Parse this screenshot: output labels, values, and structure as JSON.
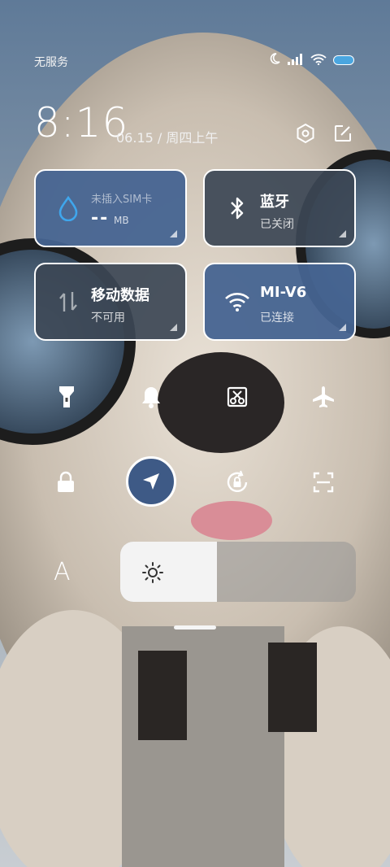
{
  "status_bar": {
    "carrier": "无服务",
    "icons": [
      "moon-icon",
      "signal-icon",
      "wifi-icon",
      "battery-icon"
    ]
  },
  "header": {
    "time": "8:16",
    "date": "06.15 / 周四上午",
    "buttons": [
      "settings-icon",
      "edit-icon"
    ]
  },
  "tiles": {
    "sim": {
      "label": "未插入SIM卡",
      "value": "--",
      "unit": "MB",
      "icon": "water-drop-icon"
    },
    "bluetooth": {
      "title": "蓝牙",
      "subtitle": "已关闭",
      "icon": "bluetooth-icon",
      "state": "off"
    },
    "mobile_data": {
      "title": "移动数据",
      "subtitle": "不可用",
      "icon": "data-arrows-icon",
      "state": "off"
    },
    "wifi": {
      "title": "MI-V6",
      "subtitle": "已连接",
      "icon": "wifi-icon",
      "state": "on"
    }
  },
  "toggles_row1": [
    "flashlight-icon",
    "bell-icon",
    "screenshot-icon",
    "airplane-icon"
  ],
  "toggles_row2": [
    "lock-icon",
    "location-icon",
    "rotation-lock-icon",
    "scan-icon"
  ],
  "active_toggle": "location-icon",
  "brightness": {
    "level": 0.41,
    "font_label": "A"
  },
  "colors": {
    "accent_on": "#466491",
    "tile_off": "#3c4655",
    "active_circle": "#3e5a86"
  }
}
